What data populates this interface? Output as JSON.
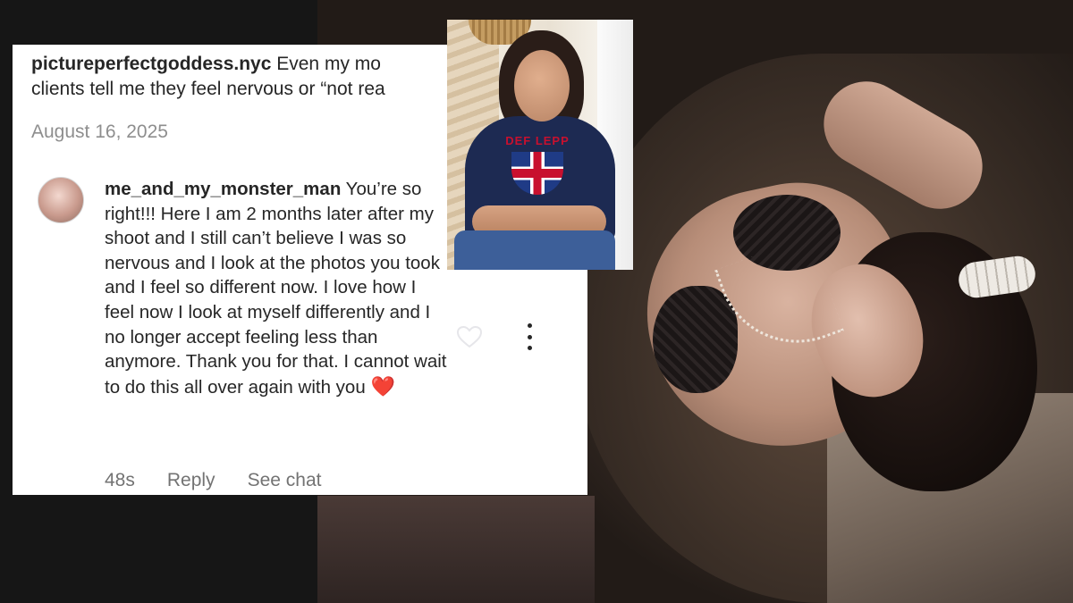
{
  "top_comment": {
    "username": "pictureperfectgoddess.nyc",
    "text": "Even my mo",
    "text_line2": "clients tell me they feel nervous or “not rea",
    "date": "August 16, 2025"
  },
  "reply": {
    "username": "me_and_my_monster_man",
    "text": "You’re so right!!! Here I am 2 months later after my shoot and I still can’t believe I was so nervous and I look at the photos you took and I feel so different now.  I love how I feel now I look at myself differently and I no longer accept feeling less than anymore. Thank you for that. I cannot wait to do this all over again with you",
    "emoji": "❤️",
    "time": "48s",
    "reply_label": "Reply",
    "see_chat_label": "See chat"
  },
  "inset_photo": {
    "shirt_text": "DEF LEPP"
  },
  "icons": {
    "like": "heart-outline-icon",
    "more": "more-vertical-icon"
  },
  "colors": {
    "text": "#262626",
    "muted": "#8e8e8e",
    "heart": "#e0252b"
  }
}
